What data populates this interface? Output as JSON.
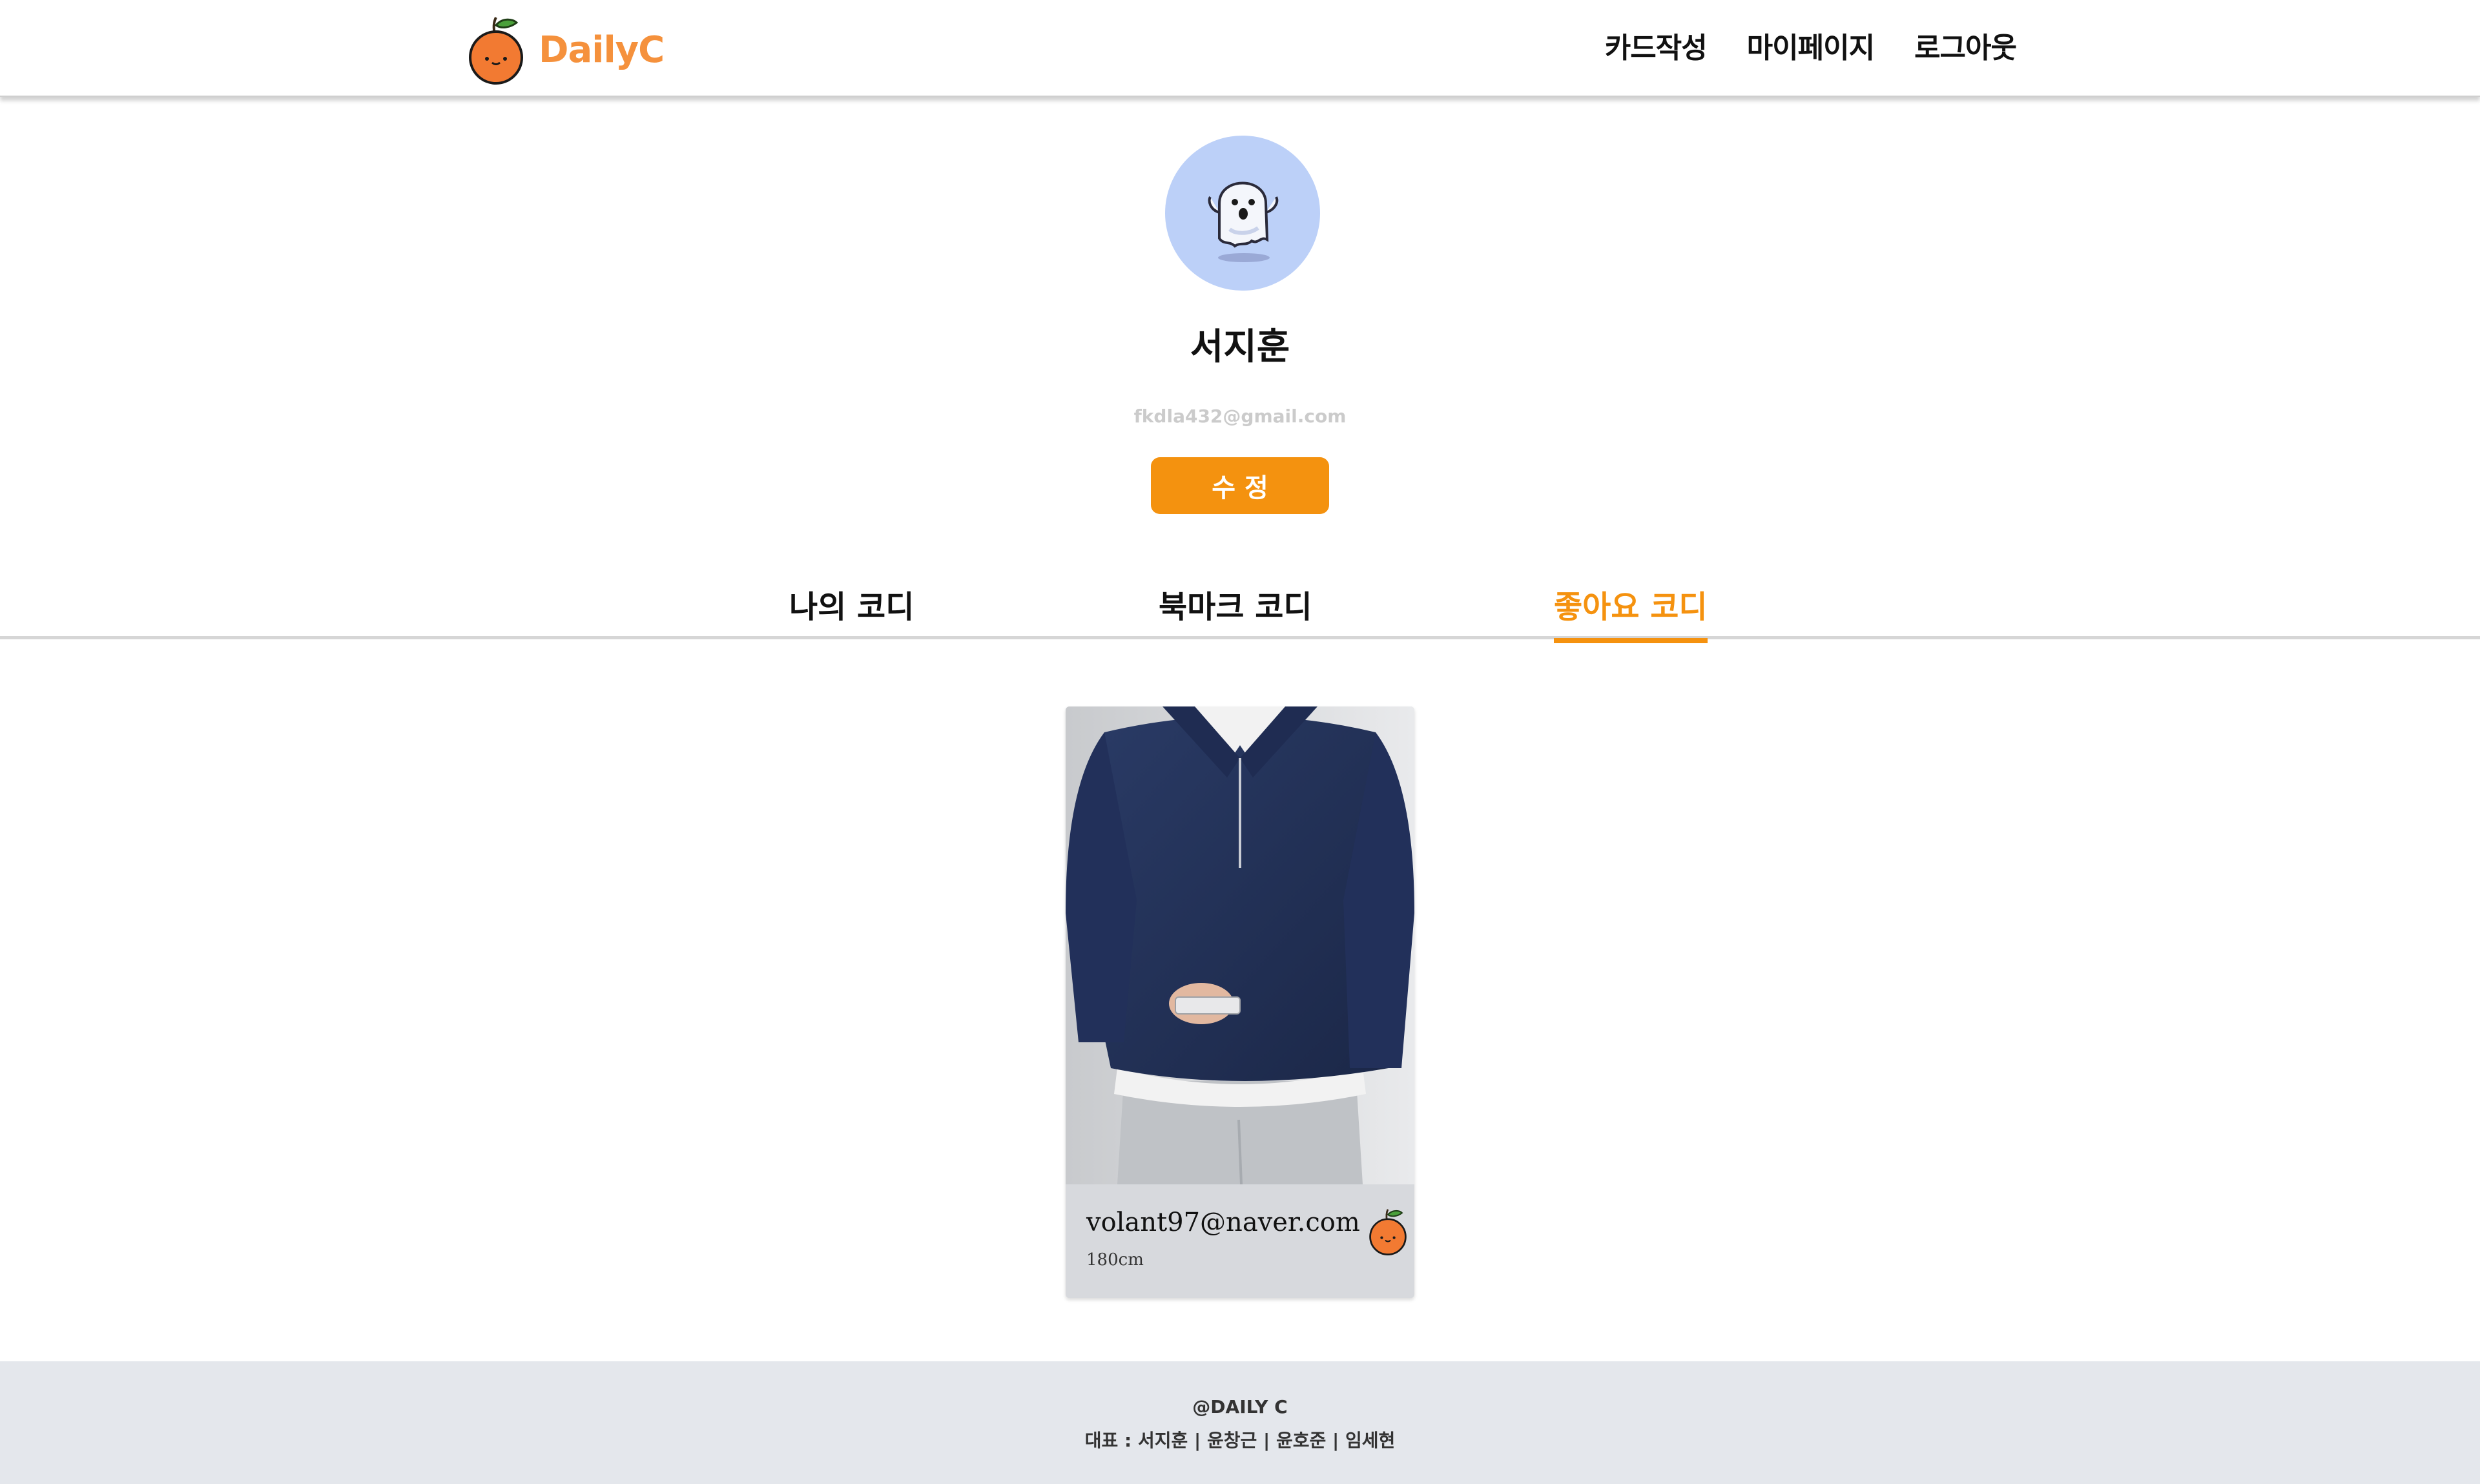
{
  "header": {
    "logo_text": "DailyC",
    "nav": {
      "write": "카드작성",
      "mypage": "마이페이지",
      "logout": "로그아웃"
    }
  },
  "profile": {
    "name": "서지훈",
    "email": "fkdla432@gmail.com",
    "edit_label": "수 정"
  },
  "tabs": [
    {
      "label": "나의 코디",
      "active": false
    },
    {
      "label": "북마크 코디",
      "active": false
    },
    {
      "label": "좋아요 코디",
      "active": true
    }
  ],
  "cards": [
    {
      "email": "volant97@naver.com",
      "height": "180cm"
    }
  ],
  "footer": {
    "brand": "@DAILY C",
    "team": "대표 : 서지훈 | 윤창근 | 윤호준 | 임세현"
  },
  "colors": {
    "accent": "#f5920f",
    "logo": "#f5913c",
    "avatar_bg": "#bcd0f8",
    "card_bg": "#d7d9dd",
    "footer_bg": "#e4e7ec"
  },
  "icons": {
    "logo": "orange-mascot-icon",
    "avatar": "ghost-icon",
    "card_badge": "orange-mascot-icon"
  }
}
